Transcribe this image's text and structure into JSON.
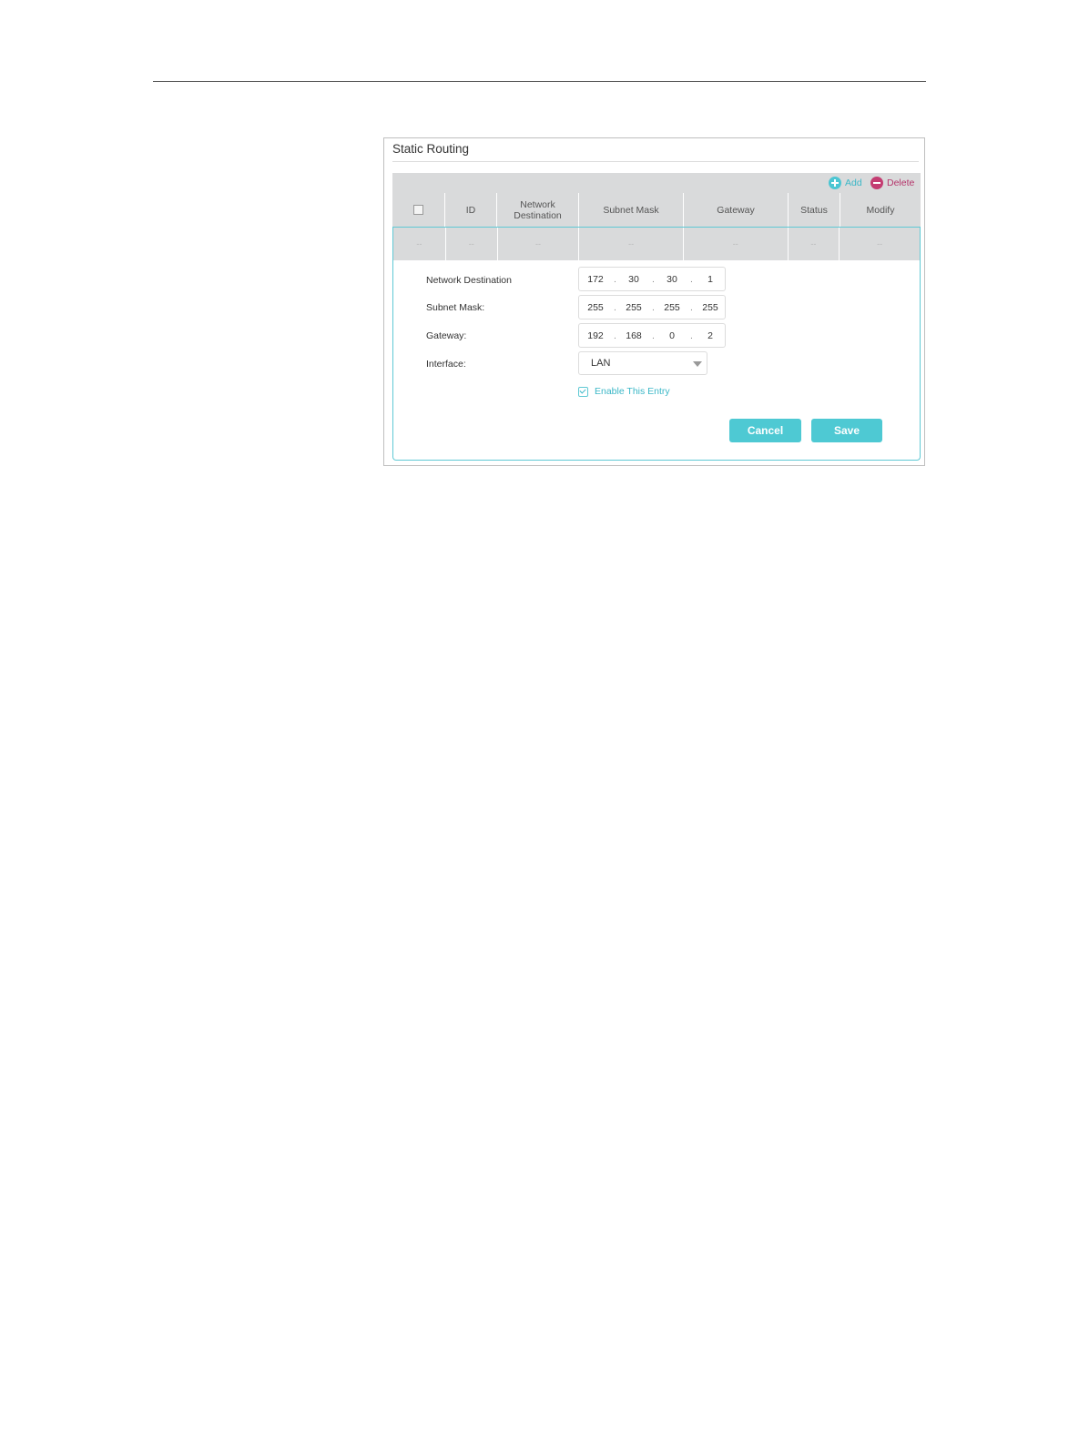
{
  "panel": {
    "title": "Static Routing"
  },
  "toolbar": {
    "add_label": "Add",
    "delete_label": "Delete"
  },
  "table": {
    "headers": [
      "",
      "ID",
      "Network\nDestination",
      "Subnet Mask",
      "Gateway",
      "Status",
      "Modify"
    ],
    "empty_row": [
      "--",
      "--",
      "--",
      "--",
      "--",
      "--",
      "--"
    ]
  },
  "form": {
    "network_destination": {
      "label": "Network Destination",
      "octets": [
        "172",
        "30",
        "30",
        "1"
      ]
    },
    "subnet_mask": {
      "label": "Subnet Mask:",
      "octets": [
        "255",
        "255",
        "255",
        "255"
      ]
    },
    "gateway": {
      "label": "Gateway:",
      "octets": [
        "192",
        "168",
        "0",
        "2"
      ]
    },
    "interface": {
      "label": "Interface:",
      "value": "LAN"
    },
    "enable_entry": {
      "label": "Enable This Entry",
      "checked": true
    }
  },
  "buttons": {
    "cancel": "Cancel",
    "save": "Save"
  },
  "colors": {
    "accent": "#4ec9d3",
    "delete": "#c43d72",
    "table_bg": "#d9dadb"
  }
}
